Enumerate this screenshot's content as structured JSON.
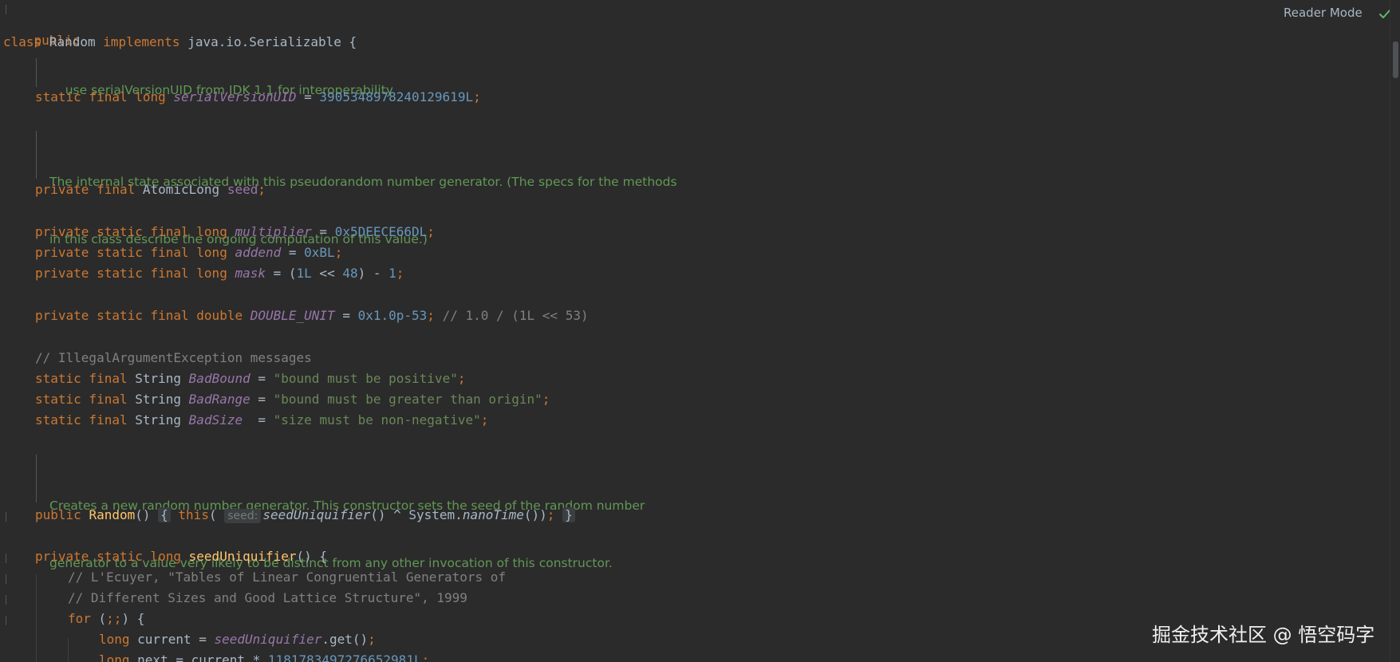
{
  "toolbar": {
    "reader_mode": "Reader Mode"
  },
  "icons": {
    "check": "check-icon"
  },
  "watermark": "掘金技术社区 @ 悟空码字",
  "code": {
    "l1_public": "public",
    "l2_class": "class",
    "l2_name": " Random ",
    "l2_implements": "implements",
    "l2_rest": " java.io.Serializable {",
    "doc1": "use serialVersionUID from JDK 1.1 for interoperability",
    "l3_mods": "static final long ",
    "l3_field": "serialVersionUID",
    "l3_eq": " = ",
    "l3_val": "3905348978240129619L",
    "semi": ";",
    "doc2_line1": "The internal state associated with this pseudorandom number generator. (The specs for the methods",
    "doc2_line2": "in this class describe the ongoing computation of this value.)",
    "l4_mods": "private final ",
    "l4_type": "AtomicLong ",
    "l4_field": "seed",
    "l5_mods": "private static final long ",
    "l5_field": "multiplier",
    "l5_val": "0x5DEECE66DL",
    "l6_field": "addend",
    "l6_val": "0xBL",
    "l7_field": "mask",
    "l7_paren_open": "(",
    "l7_one": "1L",
    "l7_shift": " << ",
    "l7_48": "48",
    "l7_rest": ") - ",
    "l7_1": "1",
    "l8_mods": "private static final double ",
    "l8_field": "DOUBLE_UNIT",
    "l8_val": "0x1.0p-53",
    "l8_comment": " // 1.0 / (1L << 53)",
    "l9_comment": "// IllegalArgumentException messages",
    "l10_mods": "static final ",
    "l10_type": "String ",
    "l10_field": "BadBound",
    "l10_val": "\"bound must be positive\"",
    "l11_field": "BadRange",
    "l11_val": "\"bound must be greater than origin\"",
    "l12_field": "BadSize",
    "l12_eq": "  = ",
    "l12_val": "\"size must be non-negative\"",
    "doc3_line1": "Creates a new random number generator. This constructor sets the seed of the random number",
    "doc3_line2": "generator to a value very likely to be distinct from any other invocation of this constructor.",
    "l13_public": "public ",
    "l13_name": "Random",
    "l13_parens": "() ",
    "l13_brace_open": "{",
    "l13_this": " this",
    "l13_paren": "(",
    "l13_hint": "seed:",
    "l13_call": "seedUniquifier",
    "l13_mid": "() ^ System.",
    "l13_nano": "nanoTime",
    "l13_end": "())",
    "l13_brace_close": "}",
    "l14_mods": "private static long ",
    "l14_name": "seedUniquifier",
    "l14_rest": "() {",
    "l15_comment": "// L'Ecuyer, \"Tables of Linear Congruential Generators of",
    "l16_comment": "// Different Sizes and Good Lattice Structure\", 1999",
    "l17_for": "for",
    "l17_open": " (",
    "l17_semis": ";;",
    "l17_close": ") {",
    "l18_long": "long",
    "l18_var": " current = ",
    "l18_call": "seedUniquifier",
    "l18_rest": ".get()",
    "l19_long": "long",
    "l19_var": " next = current * ",
    "l19_val": "1181783497276652981L"
  }
}
